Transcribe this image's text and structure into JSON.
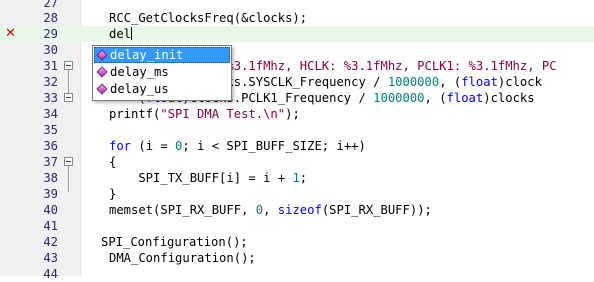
{
  "editor": {
    "lines": [
      {
        "num": "27",
        "code": ""
      },
      {
        "num": "28",
        "code": "RCC_GetClocksFreq(&clocks);"
      },
      {
        "num": "29",
        "code": "del"
      },
      {
        "num": "30",
        "code": ""
      },
      {
        "num": "31",
        "code": "                %3.1fMhz, HCLK: %3.1fMhz, PCLK1: %3.1fMhz, PC"
      },
      {
        "num": "32",
        "code": "            clocks.SYSCLK_Frequency / 1000000, (float)clock"
      },
      {
        "num": "33",
        "code": "    (float)clocks.PCLK1_Frequency / 1000000, (float)clocks"
      },
      {
        "num": "34",
        "code": "printf(\"SPI DMA Test.\\n\");"
      },
      {
        "num": "35",
        "code": ""
      },
      {
        "num": "36",
        "code": "for (i = 0; i < SPI_BUFF_SIZE; i++)"
      },
      {
        "num": "37",
        "code": "{"
      },
      {
        "num": "38",
        "code": "    SPI_TX_BUFF[i] = i + 1;"
      },
      {
        "num": "39",
        "code": "}"
      },
      {
        "num": "40",
        "code": "memset(SPI_RX_BUFF, 0, sizeof(SPI_RX_BUFF));"
      },
      {
        "num": "41",
        "code": ""
      },
      {
        "num": "42",
        "code": "SPI_Configuration();"
      },
      {
        "num": "43",
        "code": "DMA_Configuration();"
      },
      {
        "num": "44",
        "code": ""
      }
    ]
  },
  "autocomplete": {
    "items": [
      {
        "label": "delay_init",
        "selected": true
      },
      {
        "label": "delay_ms",
        "selected": false
      },
      {
        "label": "delay_us",
        "selected": false
      }
    ]
  },
  "error_marker": {
    "icon": "error-x-icon",
    "glyph": "✕"
  },
  "colors": {
    "keyword": "#0000ff",
    "string": "#8b0045",
    "number": "#008080",
    "selection": "#3399ff",
    "current_line": "#e8f8e8",
    "error": "#d40000"
  }
}
